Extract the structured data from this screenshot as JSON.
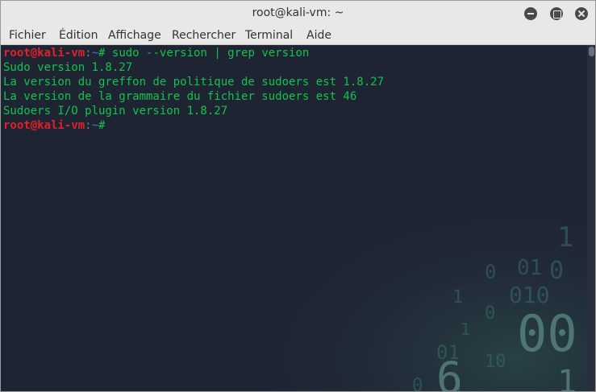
{
  "window": {
    "title": "root@kali-vm: ~"
  },
  "menubar": {
    "items": [
      "Fichier",
      "Édition",
      "Affichage",
      "Rechercher",
      "Terminal",
      "Aide"
    ]
  },
  "terminal": {
    "prompt": {
      "user_host": "root@kali-vm",
      "separator": ":",
      "path": "~",
      "symbol": "#"
    },
    "command": " sudo --version | grep version",
    "output": [
      "Sudo version 1.8.27",
      "La version du greffon de politique de sudoers est 1.8.27",
      "La version de la grammaire du fichier sudoers est 46",
      "Sudoers I/O plugin version 1.8.27"
    ]
  },
  "colors": {
    "background": "#1f2433",
    "prompt_user": "#e0202a",
    "prompt_path": "#3c78d8",
    "text": "#13c24e"
  },
  "icons": {
    "minimize": "minimize-icon",
    "maximize": "maximize-icon",
    "close": "close-icon"
  }
}
